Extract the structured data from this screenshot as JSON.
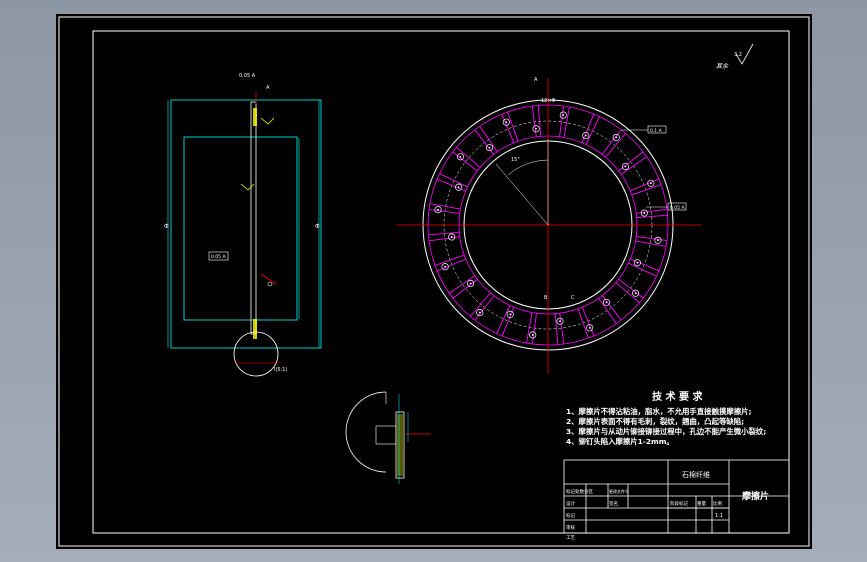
{
  "colors": {
    "background": "#000000",
    "frame": "#ffffff",
    "cyan": "#00ffff",
    "magenta": "#ff00ff",
    "red": "#ff0000",
    "yellow": "#ffff00",
    "green": "#00ff00"
  },
  "tech_requirements": {
    "title": "技 术 要 求",
    "items": [
      "1、摩擦片不得沾粘油，脂水，不允用手直接触摸摩擦片;",
      "2、摩擦片表面不得有毛刺，裂纹，翘曲，凸起等缺陷;",
      "3、摩擦片与从动片铆接铆接过程中，孔边不能产生微小裂纹;",
      "4、铆钉头陷入摩擦片1-2mm。"
    ]
  },
  "title_block": {
    "material": "石棉纤维",
    "part_name": "摩擦片",
    "scale_value": "1:1",
    "col_stage": "阶段标记",
    "col_weight": "重量",
    "col_scale": "比例",
    "row_marks": "标记",
    "row_design": "设计",
    "row_review": "审核",
    "row_process": "工艺",
    "row_change_label": "标记处数分区",
    "row_change_doc": "更改文件号",
    "row_sign": "签名"
  },
  "annotations": {
    "roughness_top_right": "3.2",
    "other_label": "其余",
    "detail_label": "I(5:1)",
    "callout_a": "A",
    "callout_b": "B",
    "callout_c": "C",
    "side_tolerance_1": "0.05 A",
    "side_tolerance_2": "0.05 A",
    "ring_tolerance_1": "0.1 A",
    "ring_tolerance_2": "0.05 A",
    "side_dim_left": "Φ",
    "side_dim_right": "Φ",
    "angle_label": "15°",
    "hole_note": "12×Φ"
  }
}
